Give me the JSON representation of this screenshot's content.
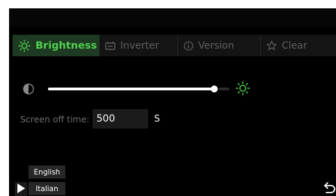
{
  "tabs": [
    {
      "label": "Brightness",
      "icon": "sun-icon",
      "active": true
    },
    {
      "label": "Inverter",
      "icon": "inverter-icon",
      "active": false
    },
    {
      "label": "Version",
      "icon": "info-icon",
      "active": false
    },
    {
      "label": "Clear",
      "icon": "star-icon",
      "active": false
    }
  ],
  "brightness": {
    "level_fraction": 0.93,
    "left_icon": "contrast-icon",
    "right_icon": "sun-icon"
  },
  "screen_off": {
    "label": "Screen off time:",
    "value": "500",
    "unit": "S"
  },
  "languages": {
    "english": "English",
    "italian": "Italian"
  },
  "controls": {
    "play_icon": "play-icon",
    "back_icon": "return-icon"
  },
  "colors": {
    "accent": "#4fd04f",
    "active_tab_bg": "#1f3a22",
    "background": "#000000"
  }
}
